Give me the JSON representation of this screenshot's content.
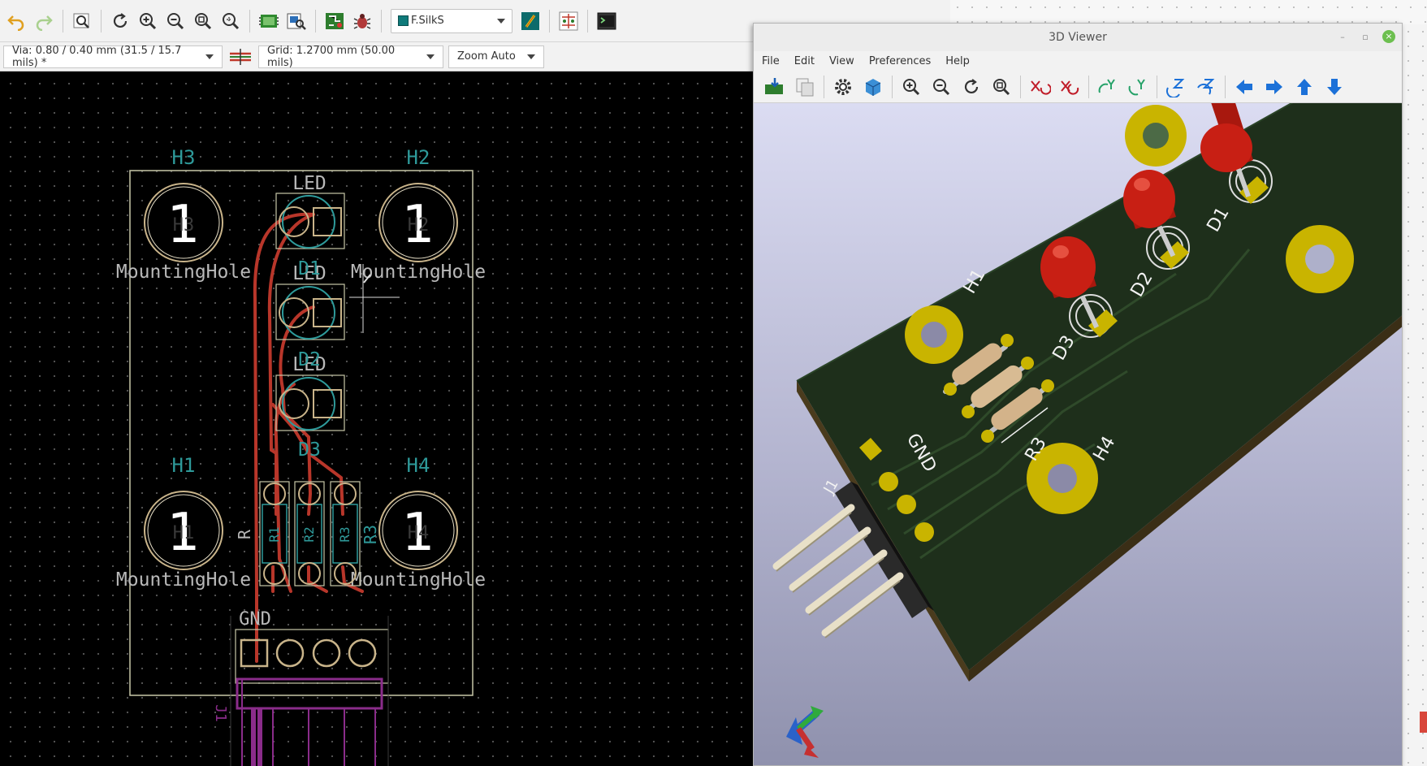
{
  "pcb_editor": {
    "toolbar": {
      "icons": [
        "undo-icon",
        "redo-icon",
        "zoom-search-icon",
        "refresh-icon",
        "zoom-in-icon",
        "zoom-out-icon",
        "zoom-fit-icon",
        "zoom-selection-icon",
        "footprint-editor-icon",
        "footprint-viewer-icon",
        "netlist-icon",
        "drc-bug-icon",
        "layer-select",
        "layer-pair-icon",
        "ratsnest-icon",
        "scripting-console-icon"
      ],
      "layer": "F.SilkS",
      "layer_color": "#0f7a7a"
    },
    "toolbar2": {
      "via": "Via: 0.80 / 0.40 mm (31.5 / 15.7 mils) *",
      "grid": "Grid: 1.2700 mm (50.00 mils)",
      "zoom": "Zoom Auto"
    },
    "board": {
      "holes": [
        {
          "ref": "H3",
          "value": "MountingHole",
          "pad": "1"
        },
        {
          "ref": "H2",
          "value": "MountingHole",
          "pad": "1"
        },
        {
          "ref": "H1",
          "value": "MountingHole",
          "pad": "1"
        },
        {
          "ref": "H4",
          "value": "MountingHole",
          "pad": "1"
        }
      ],
      "leds": [
        {
          "value": "LED",
          "ref": "D1"
        },
        {
          "value": "LED",
          "ref": "D2"
        },
        {
          "value": "LED",
          "ref": "D3"
        }
      ],
      "resistor_label": "R",
      "resistor_refs": [
        "R1",
        "R2",
        "R3"
      ],
      "resistor_side_label": "R3",
      "connector_label": "GND",
      "connector_ref": "J1",
      "colors": {
        "silk": "#c7c7a8",
        "fab": "#2e9a9a",
        "copper": "#c83a2c",
        "pad": "#c9b48a",
        "courtyard": "#8a2c8a"
      }
    }
  },
  "viewer3d": {
    "title": "3D Viewer",
    "menu": [
      "File",
      "Edit",
      "View",
      "Preferences",
      "Help"
    ],
    "toolbar_icons": [
      "reload-board-icon",
      "copy-image-icon",
      "settings-gear-icon",
      "perspective-cube-icon",
      "zoom-in-icon",
      "zoom-out-icon",
      "redraw-icon",
      "zoom-fit-icon",
      "rotate-x-cw-icon",
      "rotate-x-ccw-icon",
      "rotate-y-cw-icon",
      "rotate-y-ccw-icon",
      "rotate-z-cw-icon",
      "rotate-z-ccw-icon",
      "pan-left-icon",
      "pan-right-icon",
      "pan-up-icon",
      "pan-down-icon"
    ],
    "scene_labels": {
      "h1": "H1",
      "h4": "H4",
      "d1": "D1",
      "d2": "D2",
      "d3": "D3",
      "r3": "R3",
      "gnd": "GND",
      "j1": "J1"
    },
    "colors": {
      "board": "#22351f",
      "gold": "#c9b400",
      "led": "#c81f14",
      "resistor": "#d3b38a"
    }
  }
}
